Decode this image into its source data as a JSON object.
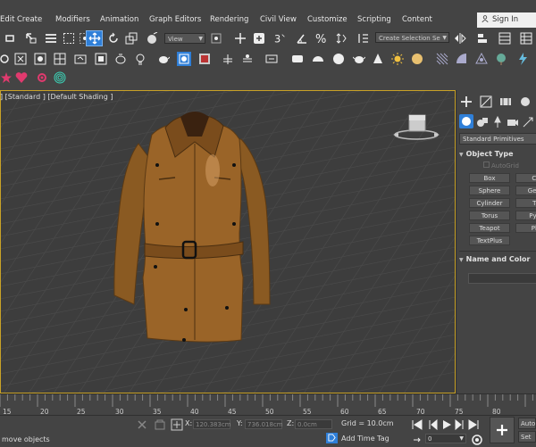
{
  "menu": {
    "items": [
      "Edit",
      "Create",
      "Modifiers",
      "Animation",
      "Graph Editors",
      "Rendering",
      "Civil View",
      "Customize",
      "Scripting",
      "Content"
    ],
    "signin": "Sign In"
  },
  "toolbar": {
    "view_dropdown": "View",
    "selection_set_dropdown": "Create Selection Se"
  },
  "viewport": {
    "label": "] [Standard ] [Default Shading ]"
  },
  "command_panel": {
    "category_dropdown": "Standard Primitives",
    "object_type_title": "Object Type",
    "autogrid_label": "AutoGrid",
    "primitives": [
      "Box",
      "Cone",
      "Sphere",
      "GeoSphere",
      "Cylinder",
      "Tube",
      "Torus",
      "Pyramid",
      "Teapot",
      "Plane",
      "TextPlus"
    ],
    "primitive_visible": [
      "Box",
      "Co",
      "Sphere",
      "GeoS",
      "Cylinder",
      "Tu",
      "Torus",
      "Pyra",
      "Teapot",
      "Pla",
      "TextPlus"
    ],
    "name_color_title": "Name and Color"
  },
  "timeline": {
    "ticks": [
      "15",
      "20",
      "25",
      "30",
      "35",
      "40",
      "45",
      "50",
      "55",
      "60",
      "65",
      "70",
      "75",
      "80"
    ]
  },
  "status": {
    "prompt": "move objects",
    "x_label": "X:",
    "x_value": "120.383cm",
    "y_label": "Y:",
    "y_value": "736.018cm",
    "z_label": "Z:",
    "z_value": "0.0cm",
    "grid": "Grid = 10.0cm",
    "add_time_tag": "Add Time Tag",
    "frame_value": "0",
    "auto_key": "Auto",
    "set_key": "Set K"
  },
  "colors": {
    "viewport_border": "#c9a227",
    "coat": "#8a5a22",
    "accent_blue": "#2f7fd8"
  }
}
